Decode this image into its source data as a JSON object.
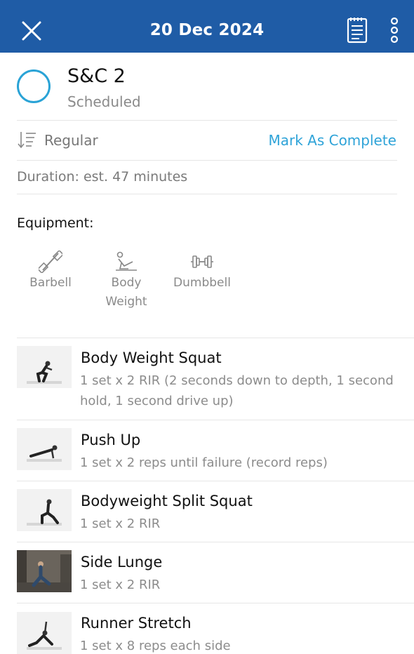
{
  "header": {
    "date": "20 Dec 2024",
    "close_icon": "close-icon",
    "notes_icon": "notepad-icon",
    "more_icon": "more-vertical-icon",
    "color": "#1f5ca6"
  },
  "workout": {
    "name": "S&C 2",
    "status": "Scheduled",
    "status_color": "#2aa3d6"
  },
  "sort": {
    "label": "Regular",
    "icon": "sort-icon"
  },
  "actions": {
    "mark_complete": "Mark As Complete",
    "accent": "#2ea3d8"
  },
  "duration": "Duration: est. 47 minutes",
  "equipment": {
    "title": "Equipment:",
    "items": [
      {
        "icon": "barbell-icon",
        "line1": "Barbell",
        "line2": ""
      },
      {
        "icon": "body-weight-icon",
        "line1": "Body",
        "line2": "Weight"
      },
      {
        "icon": "dumbbell-icon",
        "line1": "Dumbbell",
        "line2": ""
      }
    ]
  },
  "exercises": [
    {
      "name": "Body Weight Squat",
      "desc_line1": "1 set x 2 RIR (2 seconds down to depth, 1 second",
      "desc_line2": "hold, 1 second drive up)"
    },
    {
      "name": "Push Up",
      "desc_line1": "1 set x 2 reps until failure (record reps)",
      "desc_line2": ""
    },
    {
      "name": "Bodyweight Split Squat",
      "desc_line1": "1 set x 2 RIR",
      "desc_line2": ""
    },
    {
      "name": "Side Lunge",
      "desc_line1": "1 set x 2 RIR",
      "desc_line2": ""
    },
    {
      "name": "Runner Stretch",
      "desc_line1": "1 set x 8 reps each side",
      "desc_line2": ""
    }
  ]
}
